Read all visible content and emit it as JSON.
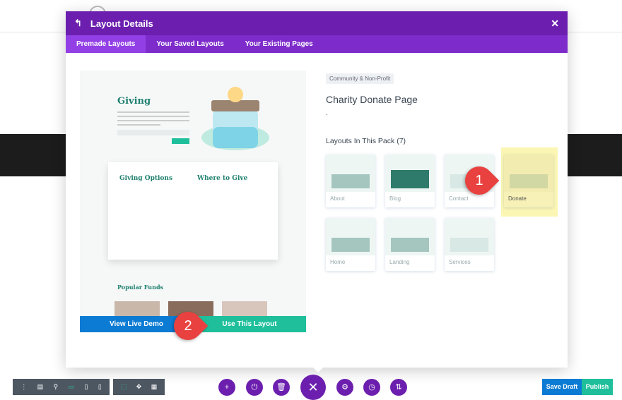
{
  "modal": {
    "title": "Layout Details",
    "tabs": [
      "Premade Layouts",
      "Your Saved Layouts",
      "Your Existing Pages"
    ]
  },
  "preview": {
    "hero_title": "Giving",
    "options_title": "Giving Options",
    "where_title": "Where to Give",
    "popular_title": "Popular Funds",
    "view_demo": "View Live Demo",
    "use_layout": "Use This Layout"
  },
  "info": {
    "category": "Community & Non-Profit",
    "title": "Charity Donate Page",
    "description": ".",
    "pack_heading": "Layouts In This Pack (7)"
  },
  "layouts": [
    "About",
    "Blog",
    "Contact",
    "Donate",
    "Home",
    "Landing",
    "Services"
  ],
  "markers": [
    "1",
    "2"
  ],
  "toolbar": {
    "save_draft": "Save Draft",
    "publish": "Publish"
  },
  "colors": {
    "purple": "#6c1fae",
    "blue": "#0c7bd3",
    "green": "#1fbf9b"
  }
}
